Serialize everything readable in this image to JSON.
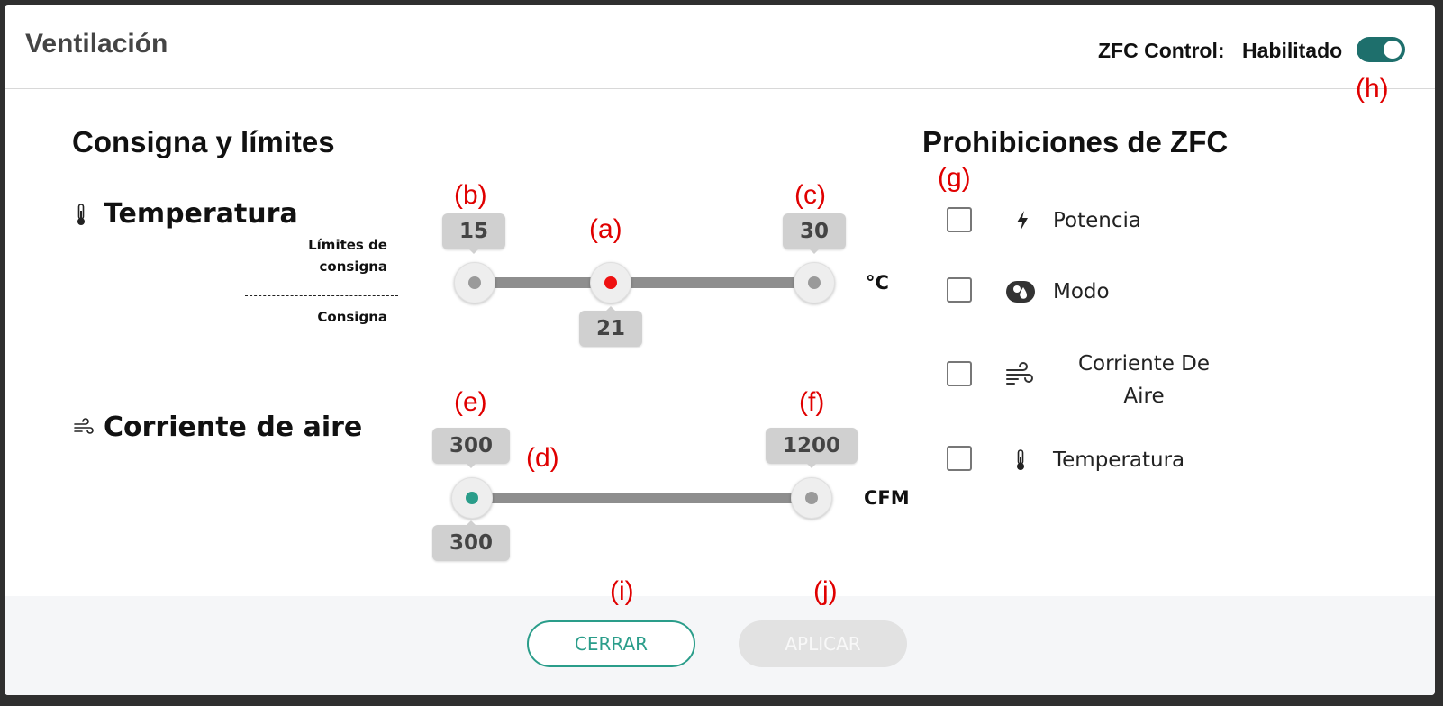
{
  "header": {
    "title": "Ventilación",
    "control_label": "ZFC Control:",
    "control_status": "Habilitado",
    "toggle_on": true
  },
  "setpoint": {
    "section_title": "Consigna y límites",
    "temperature": {
      "title": "Temperatura",
      "limits_label_line1": "Límites de",
      "limits_label_line2": "consigna",
      "setpoint_label": "Consigna",
      "min": 15,
      "max": 30,
      "value": 21,
      "unit": "°C"
    },
    "airflow": {
      "title": "Corriente de aire",
      "min": 300,
      "max": 1200,
      "value": 300,
      "unit": "CFM"
    }
  },
  "prohibitions": {
    "section_title": "Prohibiciones de ZFC",
    "items": [
      {
        "label": "Potencia",
        "icon": "lightning-icon",
        "checked": false
      },
      {
        "label": "Modo",
        "icon": "mode-icon",
        "checked": false
      },
      {
        "label": "Corriente De Aire",
        "icon": "wind-icon",
        "checked": false
      },
      {
        "label": "Temperatura",
        "icon": "thermometer-icon",
        "checked": false
      }
    ]
  },
  "footer": {
    "close_label": "CERRAR",
    "apply_label": "APLICAR"
  },
  "annotations": {
    "a": "(a)",
    "b": "(b)",
    "c": "(c)",
    "d": "(d)",
    "e": "(e)",
    "f": "(f)",
    "g": "(g)",
    "h": "(h)",
    "i": "(i)",
    "j": "(j)"
  },
  "colors": {
    "accent": "#2a9d8a",
    "toggle": "#1e6f6c",
    "setpoint_dot": "#ee1111",
    "annotation": "#e00000"
  }
}
